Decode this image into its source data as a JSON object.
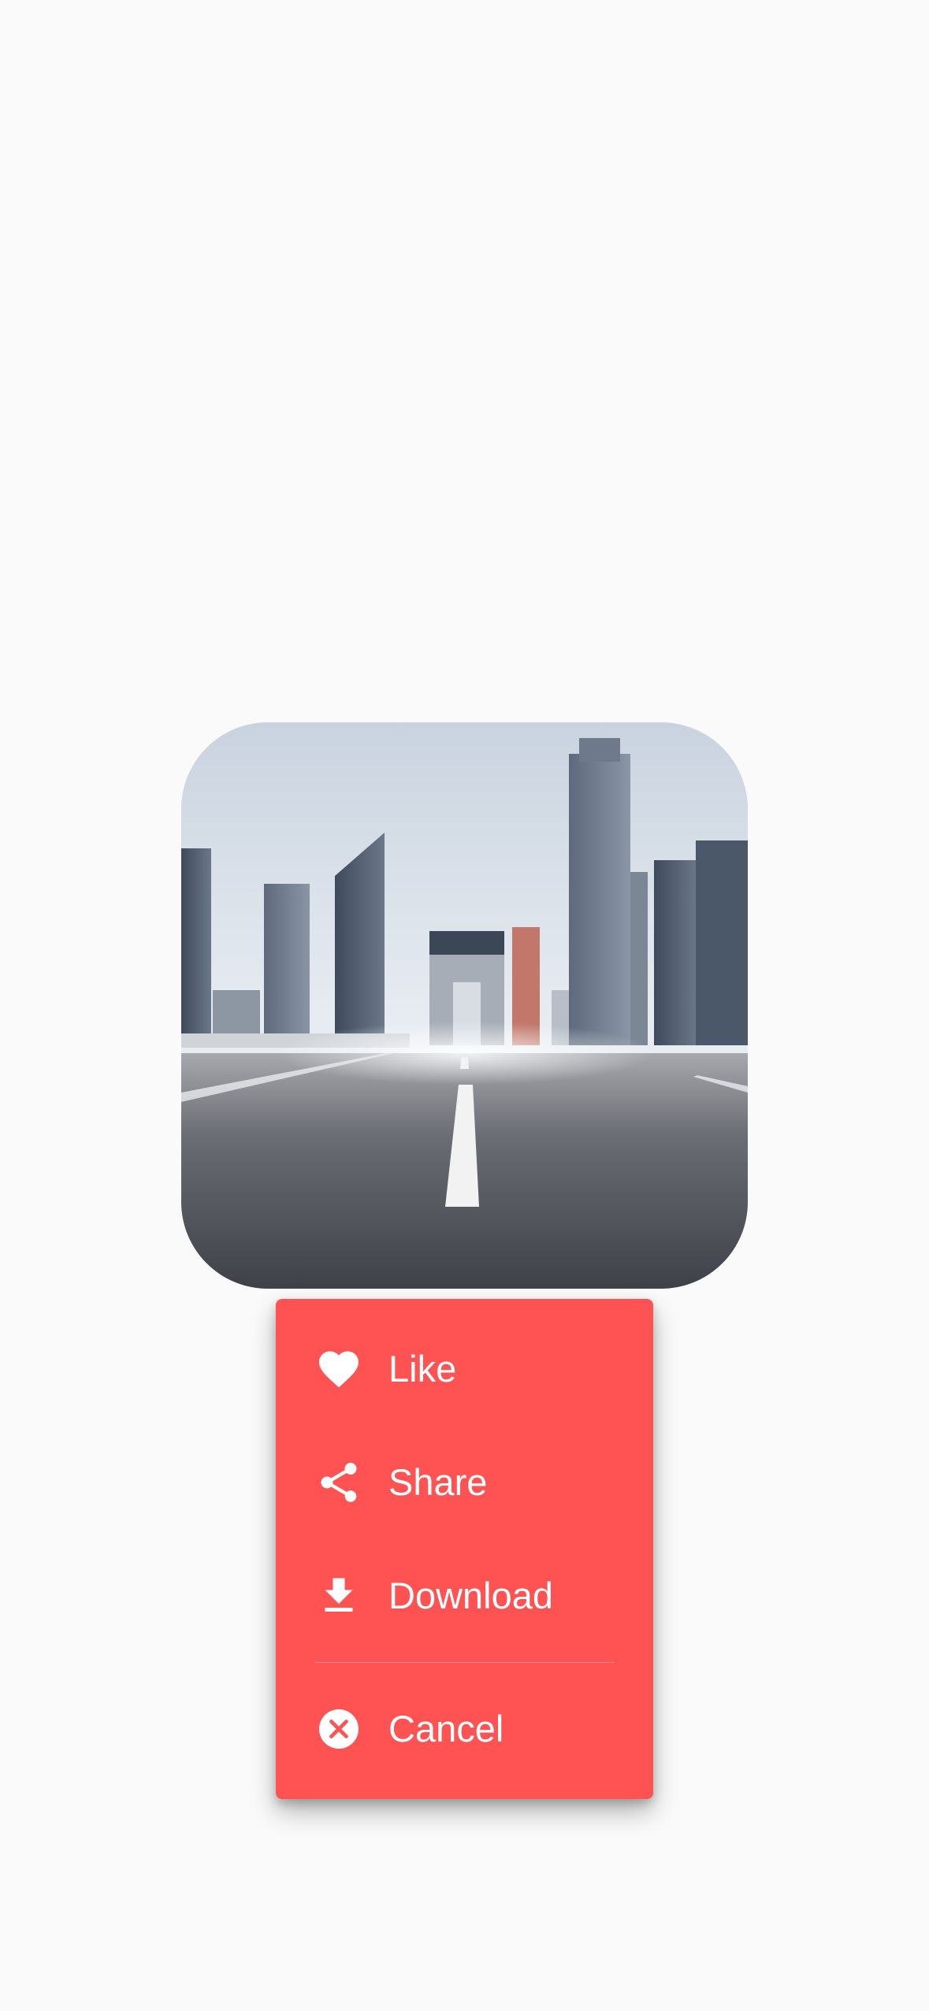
{
  "preview": {
    "subject": "city-skyline-highway-photo"
  },
  "menu": {
    "background_color": "#ff5252",
    "items": [
      {
        "label": "Like",
        "icon": "heart-icon"
      },
      {
        "label": "Share",
        "icon": "share-icon"
      },
      {
        "label": "Download",
        "icon": "download-icon"
      }
    ],
    "cancel": {
      "label": "Cancel",
      "icon": "close-circle-icon"
    }
  }
}
